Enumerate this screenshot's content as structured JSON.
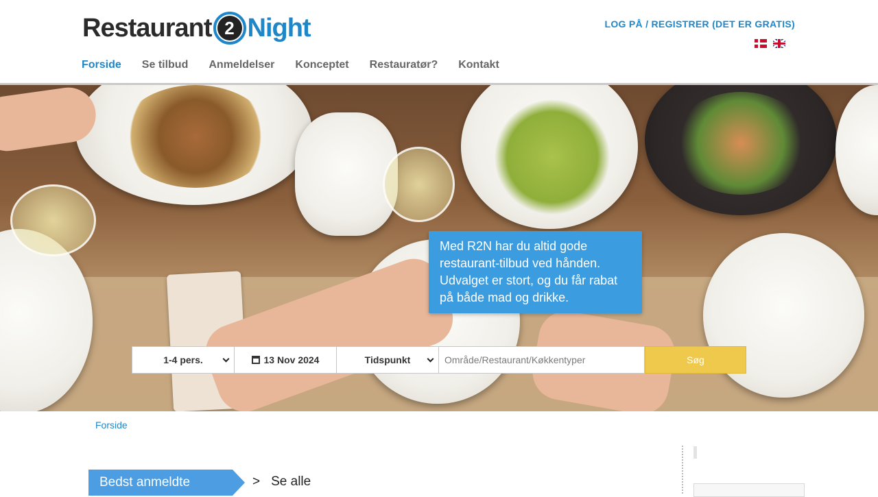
{
  "header": {
    "logo": {
      "word1": "Restaurant",
      "badge": "2",
      "word2": "Night"
    },
    "login_link": "LOG PÅ / REGISTRER (DET ER GRATIS)",
    "flags": [
      "flag-dk-icon",
      "flag-uk-icon"
    ],
    "nav": [
      {
        "label": "Forside",
        "active": true
      },
      {
        "label": "Se tilbud"
      },
      {
        "label": "Anmeldelser"
      },
      {
        "label": "Konceptet"
      },
      {
        "label": "Restauratør?"
      },
      {
        "label": "Kontakt"
      }
    ]
  },
  "hero": {
    "promo_text": "Med R2N har du altid gode restaurant-tilbud ved hånden. Udvalget er stort, og du får rabat på både mad og drikke."
  },
  "search": {
    "persons": "1-4 pers.",
    "date": "13 Nov 2024",
    "time": "Tidspunkt",
    "placeholder": "Område/Restaurant/Køkkentyper",
    "button": "Søg"
  },
  "breadcrumb": "Forside",
  "section": {
    "title": "Bedst anmeldte",
    "see_all_prefix": ">",
    "see_all": "Se alle"
  },
  "colors": {
    "brand_blue": "#1f86c8",
    "promo_blue": "#3c9ce0",
    "search_button": "#efc94c",
    "nav_text": "#666666"
  }
}
